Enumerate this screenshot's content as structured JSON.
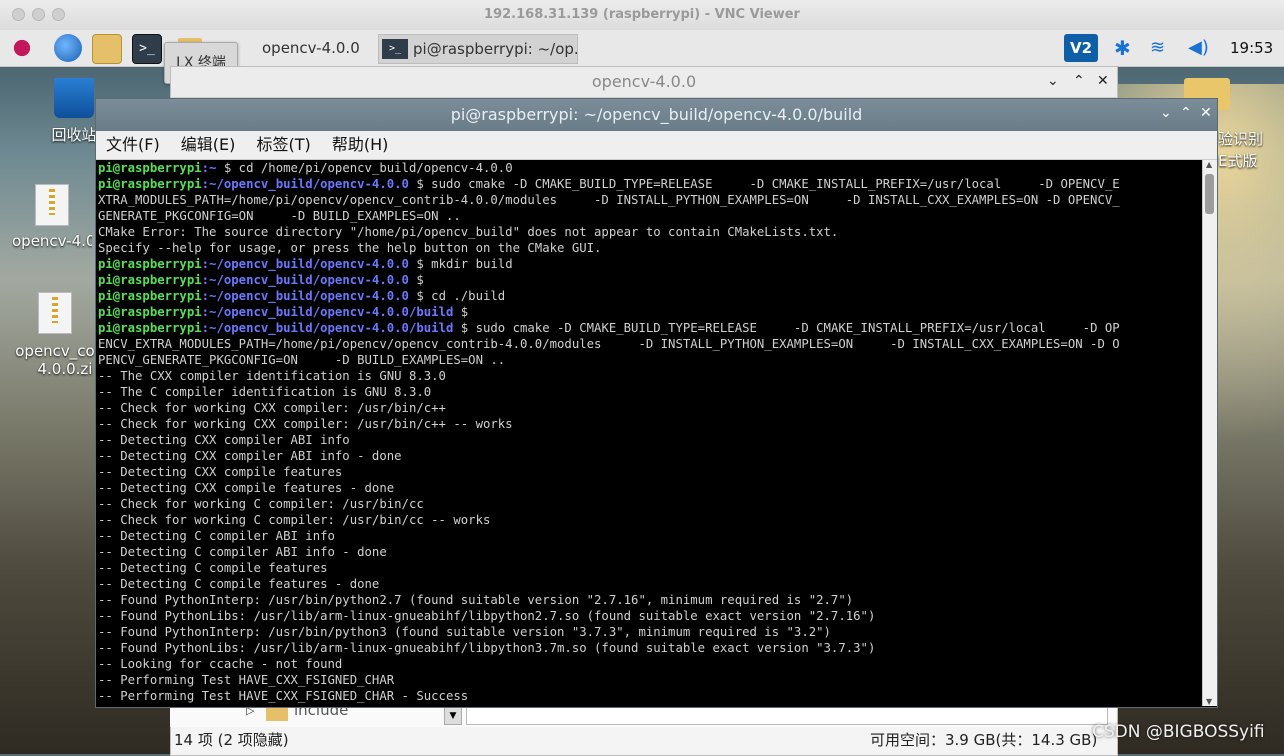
{
  "window_title": "192.168.31.139 (raspberrypi) - VNC Viewer",
  "panel": {
    "tooltip": "LX 终端",
    "tasks": [
      {
        "label": "opencv-4.0.0"
      },
      {
        "label": "pi@raspberrypi: ~/op..."
      }
    ],
    "clock": "19:53",
    "icons": [
      "raspberry-menu-icon",
      "browser-globe-icon",
      "file-manager-icon",
      "terminal-icon",
      "vnc-icon",
      "bluetooth-icon",
      "wifi-icon",
      "volume-icon"
    ]
  },
  "desktop": {
    "icons": [
      {
        "label": "回收站"
      },
      {
        "label": "opencv-4.0"
      },
      {
        "label": "opencv_co"
      },
      {
        "label": "4.0.0.zi"
      }
    ],
    "right_texts": [
      "验识别",
      "E式版"
    ]
  },
  "file_manager": {
    "title": "opencv-4.0.0",
    "folder_label": "include",
    "status_left": "14 项 (2 项隐藏)",
    "status_right": "可用空间：3.9 GB(共：14.3 GB)"
  },
  "terminal": {
    "title": "pi@raspberrypi: ~/opencv_build/opencv-4.0.0/build",
    "menu": [
      "文件(F)",
      "编辑(E)",
      "标签(T)",
      "帮助(H)"
    ],
    "lines": [
      {
        "user": "pi@raspberrypi",
        "path": ":~",
        "cmd": " $ cd /home/pi/opencv_build/opencv-4.0.0"
      },
      {
        "user": "pi@raspberrypi",
        "path": ":~/opencv_build/opencv-4.0.0",
        "cmd": " $ sudo cmake -D CMAKE_BUILD_TYPE=RELEASE     -D CMAKE_INSTALL_PREFIX=/usr/local     -D OPENCV_E"
      },
      {
        "text": "XTRA_MODULES_PATH=/home/pi/opencv/opencv_contrib-4.0.0/modules     -D INSTALL_PYTHON_EXAMPLES=ON     -D INSTALL_CXX_EXAMPLES=ON -D OPENCV_"
      },
      {
        "text": "GENERATE_PKGCONFIG=ON     -D BUILD_EXAMPLES=ON .."
      },
      {
        "text": "CMake Error: The source directory \"/home/pi/opencv_build\" does not appear to contain CMakeLists.txt."
      },
      {
        "text": "Specify --help for usage, or press the help button on the CMake GUI."
      },
      {
        "user": "pi@raspberrypi",
        "path": ":~/opencv_build/opencv-4.0.0",
        "cmd": " $ mkdir build"
      },
      {
        "user": "pi@raspberrypi",
        "path": ":~/opencv_build/opencv-4.0.0",
        "cmd": " $"
      },
      {
        "user": "pi@raspberrypi",
        "path": ":~/opencv_build/opencv-4.0.0",
        "cmd": " $ cd ./build"
      },
      {
        "user": "pi@raspberrypi",
        "path": ":~/opencv_build/opencv-4.0.0/build",
        "cmd": " $"
      },
      {
        "user": "pi@raspberrypi",
        "path": ":~/opencv_build/opencv-4.0.0/build",
        "cmd": " $ sudo cmake -D CMAKE_BUILD_TYPE=RELEASE     -D CMAKE_INSTALL_PREFIX=/usr/local     -D OP"
      },
      {
        "text": "ENCV_EXTRA_MODULES_PATH=/home/pi/opencv/opencv_contrib-4.0.0/modules     -D INSTALL_PYTHON_EXAMPLES=ON     -D INSTALL_CXX_EXAMPLES=ON -D O"
      },
      {
        "text": "PENCV_GENERATE_PKGCONFIG=ON     -D BUILD_EXAMPLES=ON .."
      },
      {
        "text": "-- The CXX compiler identification is GNU 8.3.0"
      },
      {
        "text": "-- The C compiler identification is GNU 8.3.0"
      },
      {
        "text": "-- Check for working CXX compiler: /usr/bin/c++"
      },
      {
        "text": "-- Check for working CXX compiler: /usr/bin/c++ -- works"
      },
      {
        "text": "-- Detecting CXX compiler ABI info"
      },
      {
        "text": "-- Detecting CXX compiler ABI info - done"
      },
      {
        "text": "-- Detecting CXX compile features"
      },
      {
        "text": "-- Detecting CXX compile features - done"
      },
      {
        "text": "-- Check for working C compiler: /usr/bin/cc"
      },
      {
        "text": "-- Check for working C compiler: /usr/bin/cc -- works"
      },
      {
        "text": "-- Detecting C compiler ABI info"
      },
      {
        "text": "-- Detecting C compiler ABI info - done"
      },
      {
        "text": "-- Detecting C compile features"
      },
      {
        "text": "-- Detecting C compile features - done"
      },
      {
        "text": "-- Found PythonInterp: /usr/bin/python2.7 (found suitable version \"2.7.16\", minimum required is \"2.7\")"
      },
      {
        "text": "-- Found PythonLibs: /usr/lib/arm-linux-gnueabihf/libpython2.7.so (found suitable exact version \"2.7.16\")"
      },
      {
        "text": "-- Found PythonInterp: /usr/bin/python3 (found suitable version \"3.7.3\", minimum required is \"3.2\")"
      },
      {
        "text": "-- Found PythonLibs: /usr/lib/arm-linux-gnueabihf/libpython3.7m.so (found suitable exact version \"3.7.3\")"
      },
      {
        "text": "-- Looking for ccache - not found"
      },
      {
        "text": "-- Performing Test HAVE_CXX_FSIGNED_CHAR"
      },
      {
        "text": "-- Performing Test HAVE_CXX_FSIGNED_CHAR - Success"
      }
    ]
  },
  "watermark": "CSDN @BIGBOSSyifi"
}
